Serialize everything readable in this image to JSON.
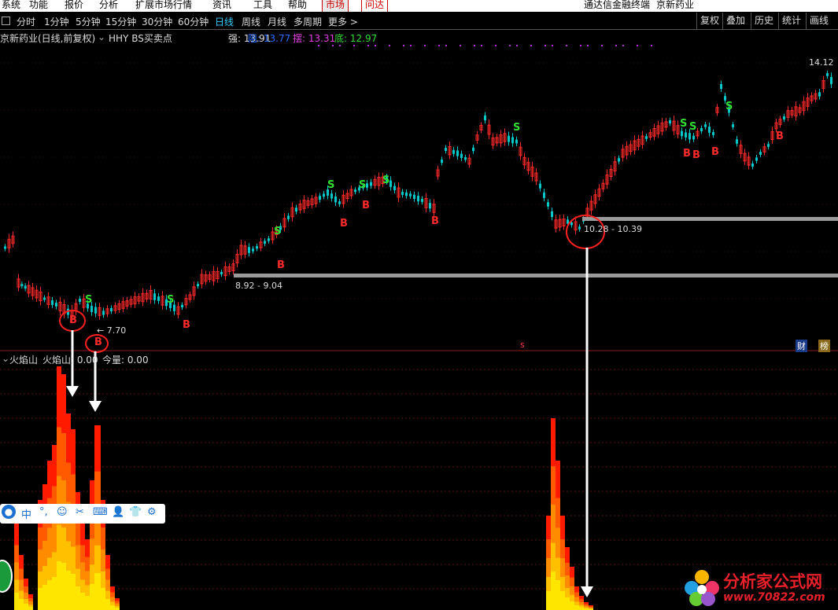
{
  "menu": {
    "items": [
      "系统",
      "功能",
      "报价",
      "分析",
      "扩展市场行情",
      "资讯",
      "工具",
      "帮助"
    ],
    "tabs": [
      "市场",
      "问达"
    ],
    "brand": "通达信金融终端",
    "stock_name": "京新药业"
  },
  "periods": {
    "items": [
      "分时",
      "1分钟",
      "5分钟",
      "15分钟",
      "30分钟",
      "60分钟",
      "日线",
      "周线",
      "月线",
      "多周期",
      "更多 >"
    ],
    "active": "日线",
    "tools": [
      "复权",
      "叠加",
      "历史",
      "统计",
      "画线"
    ]
  },
  "info": {
    "title": "京新药业(日线,前复权)",
    "indicator": "HHY BS买卖点",
    "strong_label": "强: 13.91",
    "resist_label": "阻: 13.77",
    "swing_label": "摆: 13.31",
    "bottom_label": "底: 12.97"
  },
  "chart": {
    "price_top_label": "14.12",
    "zone1_label": "8.92 - 9.04",
    "zone2_label": "10.28 - 10.39",
    "low_label": "← 7.70",
    "signal_buy": "B",
    "signal_sell": "S",
    "corner_cai": "财",
    "corner_bang": "榜",
    "corner_s": "s"
  },
  "chart_data": {
    "type": "candlestick",
    "price_max_label": 14.12,
    "price_min_label": 7.7,
    "support_zones": [
      {
        "label": "8.92 - 9.04"
      },
      {
        "label": "10.28 - 10.39"
      }
    ]
  },
  "lower": {
    "name": "火焰山",
    "line": "火焰山: 0.00",
    "volume": "今量: 0.00"
  },
  "ime": {
    "labels": [
      "中",
      "°,",
      "☺",
      "✂",
      "⌨",
      "👤",
      "👕",
      "⚙"
    ]
  },
  "watermark": {
    "title": "分析家公式网",
    "url": "www.70822.com"
  },
  "colors": {
    "up": "#ff2a2a",
    "down": "#00c8c8",
    "buy": "#ff2a2a",
    "sell": "#33dd33",
    "flame_red": "#ff1a00",
    "flame_orange": "#ff8c00",
    "flame_yellow": "#ffe600"
  }
}
